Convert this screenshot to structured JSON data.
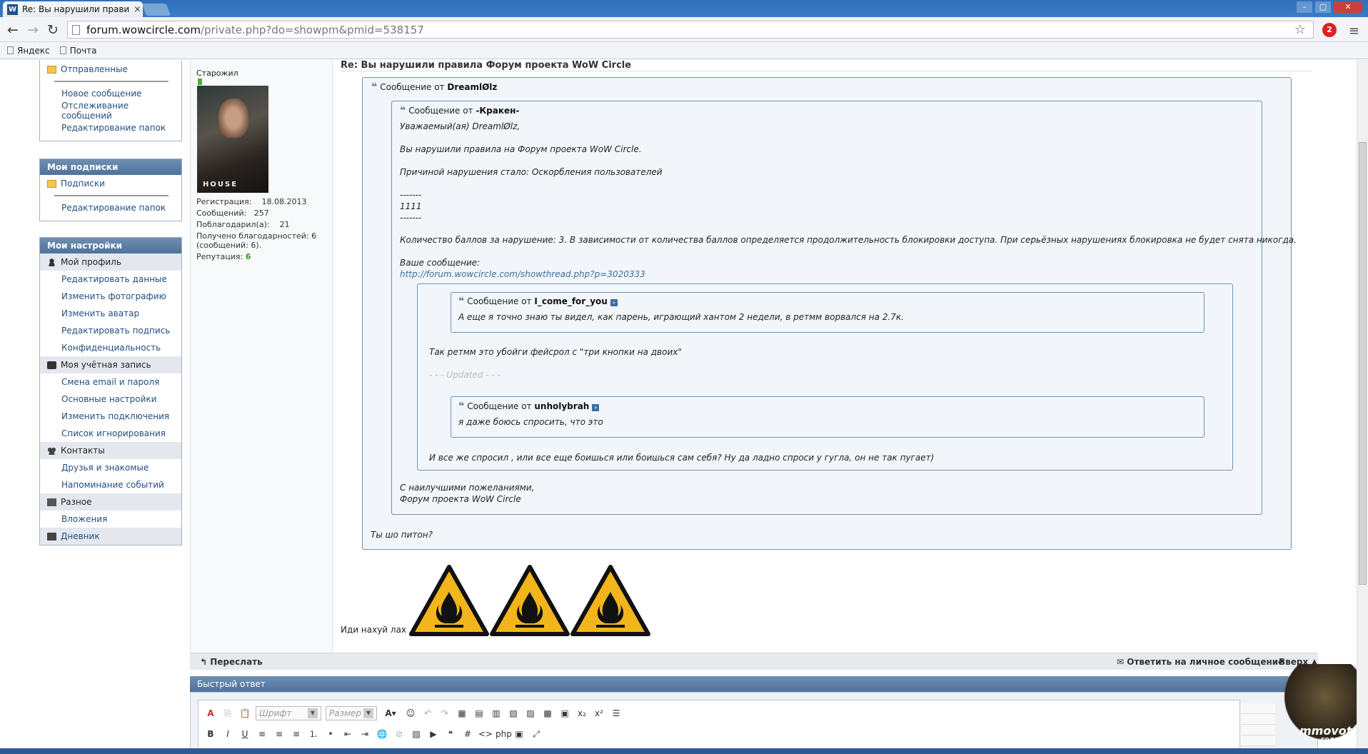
{
  "browser": {
    "tab_title": "Re: Вы нарушили прави…",
    "tab_close": "×",
    "url_host": "forum.wowcircle.com",
    "url_path": "/private.php?do=showpm&pmid=538157",
    "bookmarks": [
      "Яндекс",
      "Почта"
    ],
    "ext_badge": "2"
  },
  "sidebar": {
    "folders": {
      "sent": "Отправленные",
      "items": [
        "Новое сообщение",
        "Отслеживание сообщений",
        "Редактирование папок"
      ]
    },
    "subscriptions": {
      "title": "Мои подписки",
      "folder": "Подписки",
      "items": [
        "Редактирование папок"
      ]
    },
    "settings": {
      "title": "Мои настройки",
      "profile": "Мой профиль",
      "profile_items": [
        "Редактировать данные",
        "Изменить фотографию",
        "Изменить аватар",
        "Редактировать подпись",
        "Конфиденциальность"
      ],
      "account": "Моя учётная запись",
      "account_items": [
        "Смена email и пароля",
        "Основные настройки",
        "Изменить подключения",
        "Список игнорирования"
      ],
      "contacts": "Контакты",
      "contacts_items": [
        "Друзья и знакомые",
        "Напоминание событий"
      ],
      "misc": "Разное",
      "misc_items": [
        "Вложения"
      ],
      "diary": "Дневник"
    }
  },
  "user": {
    "title": "Старожил",
    "avatar_logo": "HOUSE",
    "reg_label": "Регистрация:",
    "reg_value": "18.08.2013",
    "posts_label": "Сообщений:",
    "posts_value": "257",
    "thanked_label": "Поблагодарил(а):",
    "thanked_value": "21",
    "received_line1": "Получено благодарностей: 6",
    "received_line2": "(сообщений: 6).",
    "rep_label": "Репутация:",
    "rep_value": "6"
  },
  "post": {
    "title": "Re: Вы нарушили правила Форум проекта WoW Circle",
    "quote_prefix": "Сообщение от",
    "q1_author": "DreamlØlz",
    "q2_author": "-Кракен-",
    "q2_lines": {
      "greeting": "Уважаемый(ая) DreamlØlz,",
      "violation": "Вы нарушили правила на Форум проекта WoW Circle.",
      "reason": "Причиной нарушения стало: Оскорбления пользователей",
      "dash1": "-------",
      "code": "1111",
      "dash2": "-------",
      "points": "Количество баллов за нарушение: 3. В зависимости от количества баллов определяется продолжительность блокировки доступа. При серьёзных нарушениях блокировка не будет снята никогда.",
      "your_message": "Ваше сообщение:",
      "link": "http://forum.wowcircle.com/showthread.php?p=3020333",
      "regards": "С наилучшими пожеланиями,",
      "signature": "Форум проекта WoW Circle"
    },
    "q4_author": "I_come_for_you",
    "q4_text": "А еще я точно знаю ты видел, как парень, играющий хантом 2 недели, в ретмм ворвался на 2.7к.",
    "reply1": "Так ретмм это убойги фейсрол с \"три кнопки на двоих\"",
    "updated": "- - - Updated - - -",
    "q5_author": "unholybrah",
    "q5_text": "я даже боюсь спросить, что это",
    "reply2": "И все же спросил , или все еще боишься или боишься сам себя? Ну да ладно спроси у гугла, он не так пугает)",
    "outer_reply": "Ты шо питон?",
    "plain": "Иди нахуй лах"
  },
  "footer": {
    "forward": "Переслать",
    "reply_pm": "Ответить на личное сообщение",
    "top": "Вверх",
    "quick_reply": "Быстрый ответ",
    "font_placeholder": "Шрифт",
    "size_placeholder": "Размер"
  },
  "ad": {
    "brand": "mmovote",
    "sub": "ГОЛОСУЙ"
  },
  "colors": {
    "accent": "#4f729b",
    "link": "#224e82",
    "quote_border": "#6e93b8",
    "warning_yellow": "#f2b51c"
  }
}
